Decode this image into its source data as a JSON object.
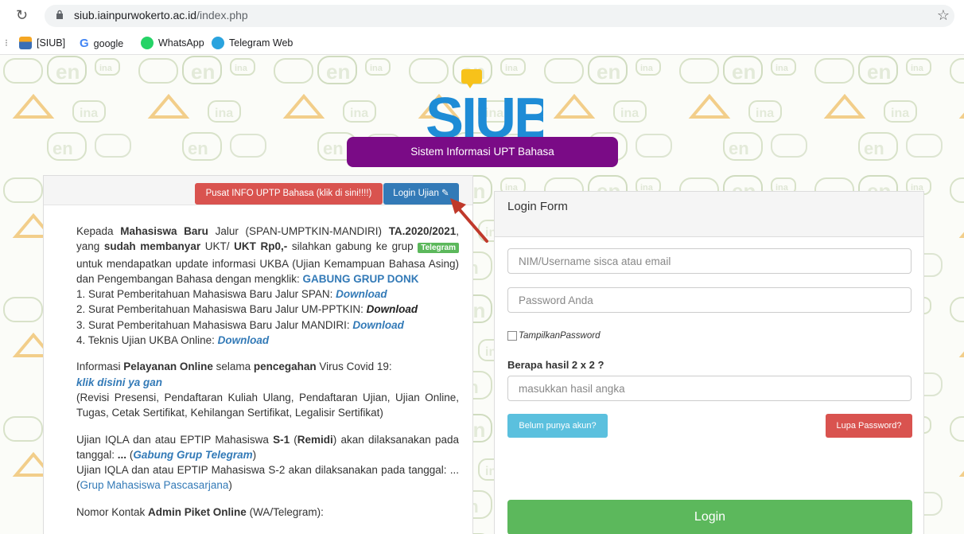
{
  "browser": {
    "url_host": "siub.iainpurwokerto.ac.id",
    "url_path": "/index.php",
    "bookmarks": [
      {
        "label": "[SIUB]",
        "icon": "siub-favicon-icon",
        "color": "#3b6fb6"
      },
      {
        "label": "google",
        "icon": "google-icon",
        "color": "#4285f4"
      },
      {
        "label": "WhatsApp",
        "icon": "whatsapp-icon",
        "color": "#25d366"
      },
      {
        "label": "Telegram Web",
        "icon": "telegram-icon",
        "color": "#2aa3de"
      }
    ]
  },
  "header": {
    "logo_text": "SIUB",
    "subtitle": "Sistem Informasi UPT Bahasa",
    "accent": "#7a0b86"
  },
  "left_panel": {
    "info_button": "Pusat INFO UPTP Bahasa (klik di sini!!!!)",
    "login_ujian_button": "Login Ujian",
    "p1": {
      "a": "Kepada ",
      "b": "Mahasiswa Baru",
      "c": " Jalur (SPAN-UMPTKIN-MANDIRI) ",
      "d": "TA.2020/2021",
      "e": ", yang ",
      "f": "sudah membanyar",
      "g": " UKT/ ",
      "h": "UKT Rp0,-",
      "i": " silahkan gabung ke grup ",
      "telegram_badge": "Telegram",
      "j": " untuk mendapatkan update informasi UKBA (Ujian Kemampuan Bahasa Asing) dan Pengembangan Bahasa dengan mengklik: ",
      "gabung": "GABUNG GRUP DONK"
    },
    "list": [
      {
        "text": "1. Surat Pemberitahuan Mahasiswa Baru Jalur SPAN: ",
        "link": "Download"
      },
      {
        "text": "2. Surat Pemberitahuan Mahasiswa Baru Jalur UM-PPTKIN: ",
        "link": "Download"
      },
      {
        "text": "3. Surat Pemberitahuan Mahasiswa Baru Jalur MANDIRI: ",
        "link": "Download"
      },
      {
        "text": "4. Teknis Ujian UKBA Online: ",
        "link": "Download"
      }
    ],
    "p2": {
      "a": "Informasi ",
      "b": "Pelayanan Online",
      "c": " selama ",
      "d": "pencegahan",
      "e": " Virus Covid 19:",
      "link": "klik disini ya gan",
      "f": "(Revisi Presensi, Pendaftaran Kuliah Ulang, Pendaftaran Ujian, Ujian Online, Tugas, Cetak Sertifikat, Kehilangan Sertifikat, Legalisir Sertifikat)"
    },
    "p3": {
      "a": "Ujian IQLA dan atau EPTIP Mahasiswa ",
      "b": "S-1",
      "c": " (",
      "d": "Remidi",
      "e": ") akan dilaksanakan pada tanggal: ",
      "f": "...",
      "g": " (",
      "link": "Gabung Grup Telegram",
      "h": ")",
      "i": "Ujian IQLA dan atau EPTIP Mahasiswa S-2 akan dilaksanakan pada tanggal: ... (",
      "link2": "Grup Mahasiswa Pascasarjana",
      "j": ")"
    },
    "p4": {
      "a": "Nomor Kontak ",
      "b": "Admin Piket Online",
      "c": " (WA/Telegram):"
    }
  },
  "login_form": {
    "title": "Login Form",
    "username_placeholder": "NIM/Username sisca atau email",
    "password_placeholder": "Password Anda",
    "show_password_label": "TampilkanPassword",
    "question": "Berapa hasil 2 x 2 ?",
    "answer_placeholder": "masukkan hasil angka",
    "register_button": "Belum punya akun?",
    "forgot_button": "Lupa Password?",
    "login_button": "Login"
  }
}
